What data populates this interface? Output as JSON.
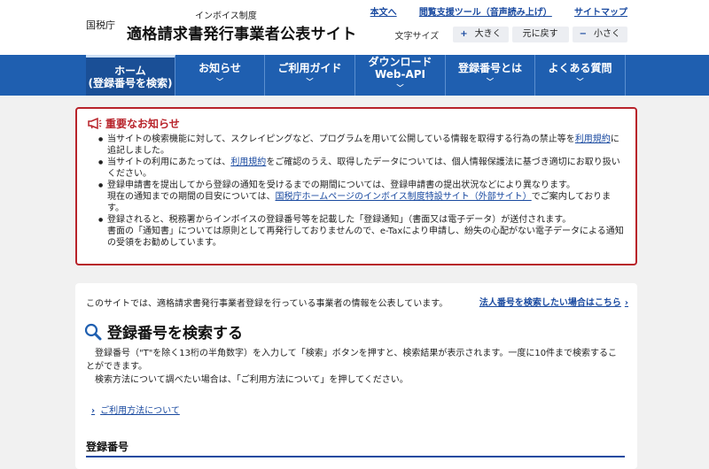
{
  "header": {
    "agency": "国税庁",
    "subtitle": "インボイス制度",
    "title": "適格請求書発行事業者公表サイト",
    "links": [
      "本文へ",
      "閲覧支援ツール（音声読み上げ）",
      "サイトマップ"
    ],
    "font_size": {
      "label": "文字サイズ",
      "larger": "大きく",
      "reset": "元に戻す",
      "smaller": "小さく"
    }
  },
  "nav": {
    "items": [
      {
        "line1": "ホーム",
        "line2": "(登録番号を検索)"
      },
      {
        "line1": "お知らせ",
        "line2": ""
      },
      {
        "line1": "ご利用ガイド",
        "line2": ""
      },
      {
        "line1": "ダウンロード",
        "line2": "Web-API"
      },
      {
        "line1": "登録番号とは",
        "line2": ""
      },
      {
        "line1": "よくある質問",
        "line2": ""
      }
    ]
  },
  "notice": {
    "title": "重要なお知らせ",
    "item1_a": "当サイトの検索機能に対して、スクレイピングなど、プログラムを用いて公開している情報を取得する行為の禁止等を",
    "item1_link": "利用規約",
    "item1_b": "に追記しました。",
    "item2_a": "当サイトの利用にあたっては、",
    "item2_link": "利用規約",
    "item2_b": "をご確認のうえ、取得したデータについては、個人情報保護法に基づき適切にお取り扱いください。",
    "item3_a": "登録申請書を提出してから登録の通知を受けるまでの期間については、登録申請書の提出状況などにより異なります。",
    "item3_b": "現在の通知までの期間の目安については、",
    "item3_link": "国税庁ホームページのインボイス制度特設サイト（外部サイト）",
    "item3_c": "でご案内しております。",
    "item4_a": "登録されると、税務署からインボイスの登録番号等を記載した「登録通知」（書面又は電子データ）が送付されます。",
    "item4_b": "書面の「通知書」については原則として再発行しておりませんので、e-Taxにより申請し、紛失の心配がない電子データによる通知の受領をお勧めしています。"
  },
  "main": {
    "intro": "このサイトでは、適格請求書発行事業者登録を行っている事業者の情報を公表しています。",
    "corp_link": "法人番号を検索したい場合はこちら",
    "search_heading": "登録番号を検索する",
    "desc1": "登録番号（\"T\"を除く13桁の半角数字）を入力して「検索」ボタンを押すと、検索結果が表示されます。一度に10件まで検索することができます。",
    "desc2": "検索方法について調べたい場合は、「ご利用方法について」を押してください。",
    "howto_link": "ご利用方法について",
    "reg_label": "登録番号"
  }
}
